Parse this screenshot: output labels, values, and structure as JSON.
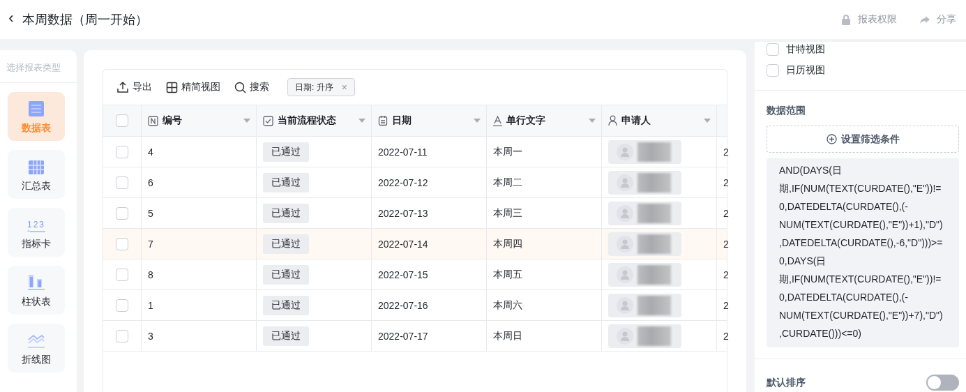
{
  "header": {
    "back": "‹",
    "title": "本周数据（周一开始）",
    "actions": [
      {
        "kind": "lock",
        "label": "报表权限"
      },
      {
        "kind": "share",
        "label": "分享"
      }
    ]
  },
  "sidebar": {
    "title": "选择报表类型",
    "items": [
      {
        "kind": "table",
        "label": "数据表",
        "selected": true
      },
      {
        "kind": "pivot",
        "label": "汇总表",
        "selected": false
      },
      {
        "kind": "metric",
        "icon_text": "123",
        "label": "指标卡",
        "selected": false
      },
      {
        "kind": "bar",
        "label": "柱状表",
        "selected": false
      },
      {
        "kind": "line",
        "label": "折线图",
        "selected": false
      }
    ]
  },
  "toolbar": {
    "buttons": [
      {
        "kind": "export",
        "label": "导出"
      },
      {
        "kind": "compact",
        "label": "精简视图"
      },
      {
        "kind": "search",
        "label": "搜索"
      }
    ],
    "sort_chip": {
      "label": "日期: 升序",
      "close": "×"
    }
  },
  "table": {
    "select_all_checked": false,
    "columns": [
      {
        "kind": "number",
        "label": "编号"
      },
      {
        "kind": "flow",
        "label": "当前流程状态"
      },
      {
        "kind": "date",
        "label": "日期"
      },
      {
        "kind": "text",
        "label": "单行文字"
      },
      {
        "kind": "member",
        "label": "申请人"
      }
    ],
    "rows": [
      {
        "checked": false,
        "hovered": false,
        "id": "4",
        "status": "已通过",
        "date": "2022-07-11",
        "text": "本周一",
        "column_7": "2"
      },
      {
        "checked": false,
        "hovered": false,
        "id": "6",
        "status": "已通过",
        "date": "2022-07-12",
        "text": "本周二",
        "column_7": "2"
      },
      {
        "checked": false,
        "hovered": false,
        "id": "5",
        "status": "已通过",
        "date": "2022-07-13",
        "text": "本周三",
        "column_7": "2"
      },
      {
        "checked": false,
        "hovered": true,
        "id": "7",
        "status": "已通过",
        "date": "2022-07-14",
        "text": "本周四",
        "column_7": "2"
      },
      {
        "checked": false,
        "hovered": false,
        "id": "8",
        "status": "已通过",
        "date": "2022-07-15",
        "text": "本周五",
        "column_7": "2"
      },
      {
        "checked": false,
        "hovered": false,
        "id": "1",
        "status": "已通过",
        "date": "2022-07-16",
        "text": "本周六",
        "column_7": "2"
      },
      {
        "checked": false,
        "hovered": false,
        "id": "3",
        "status": "已通过",
        "date": "2022-07-17",
        "text": "本周日",
        "column_7": "2"
      }
    ]
  },
  "settings": {
    "views": [
      {
        "label": "甘特视图",
        "checked": false
      },
      {
        "label": "日历视图",
        "checked": false
      }
    ],
    "data_range": {
      "title": "数据范围",
      "add_button": "设置筛选条件",
      "formula": "AND(DAYS(日期,IF(NUM(TEXT(CURDATE(),\"E\"))!=0,DATEDELTA(CURDATE(),(-NUM(TEXT(CURDATE(),\"E\"))+1),\"D\"),DATEDELTA(CURDATE(),-6,\"D\")))>=0,DAYS(日期,IF(NUM(TEXT(CURDATE(),\"E\"))!=0,DATEDELTA(CURDATE(),(-NUM(TEXT(CURDATE(),\"E\"))+7),\"D\"),CURDATE()))<=0)"
    },
    "default_sort": {
      "label": "默认排序",
      "on": false
    }
  }
}
